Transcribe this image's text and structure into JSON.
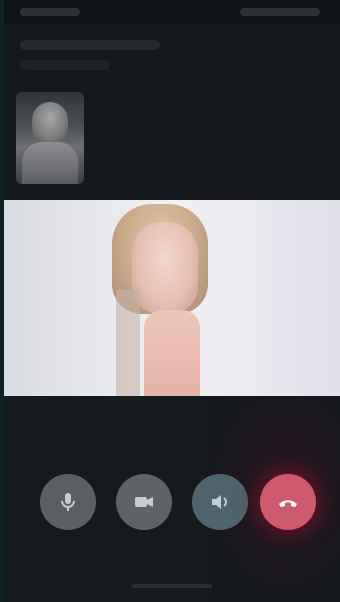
{
  "screen": {
    "type": "video-call"
  },
  "controls": {
    "mute_icon": "microphone-icon",
    "camera_icon": "video-camera-icon",
    "speaker_icon": "speaker-icon",
    "end_call_icon": "end-call-icon"
  },
  "colors": {
    "end_call": "#cf5a6e",
    "control_button": "#5c6064",
    "background": "#111518"
  }
}
